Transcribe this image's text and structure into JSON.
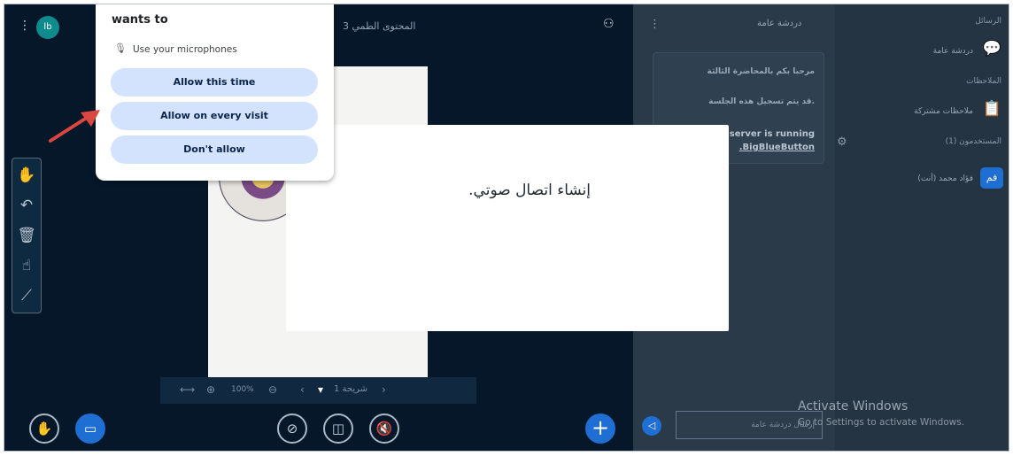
{
  "topbar": {
    "app_logo": "lb",
    "presentation_title": "المحتوى الطمي 3",
    "icons": [
      "kebab-menu-icon",
      "user-list-icon"
    ]
  },
  "toolbar": {
    "tools": [
      "hand-icon",
      "undo-icon",
      "trash-icon",
      "pointer-icon",
      "chart-icon"
    ]
  },
  "slide_nav": {
    "fit": "⟷",
    "zoom_in": "⊕",
    "zoom_level": "100%",
    "zoom_out": "⊖",
    "prev": "‹",
    "slide_label": "شريحة 1",
    "dropdown": "▾",
    "next": "›"
  },
  "bottom_controls": {
    "raise_hand": "✋",
    "present": "▭",
    "screen_share": "⊘",
    "camera": "◫",
    "audio": "🔇",
    "plus": "+"
  },
  "chat": {
    "title": "دردشة عامة",
    "messages": [
      "مرحبا بكم بالمحاضرة الثالثة",
      "قد يتم تسجيل هذه الجلسة.",
      "is server is running",
      ".BigBlueButton"
    ],
    "input_placeholder": "إرسال دردشة عامة",
    "send": "◁"
  },
  "users_panel": {
    "messages_label": "الرسائل",
    "public_chat": "دردشة عامة",
    "notes_label": "الملاحظات",
    "shared_notes": "ملاحظات مشتركة",
    "users_label": "المستخدمون (1)",
    "user_name": "فؤاد محمد (أنت)",
    "avatar": "فم"
  },
  "modal": {
    "text": "إنشاء اتصال صوتي."
  },
  "permission_popup": {
    "heading": "wants to",
    "mic_label": "Use your microphones",
    "buttons": [
      "Allow this time",
      "Allow on every visit",
      "Don't allow"
    ]
  },
  "watermark": {
    "title": "Activate Windows",
    "subtitle": "Go to Settings to activate Windows."
  },
  "colors": {
    "arrow": "#d9473f",
    "accent": "#1f6ed4",
    "popup_button": "#d3e3fd"
  }
}
